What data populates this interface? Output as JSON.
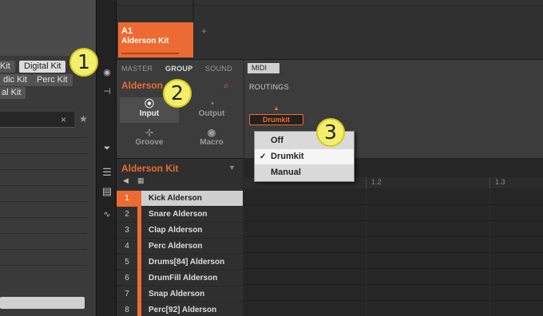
{
  "browser": {
    "kits": [
      "Kit",
      "Digital Kit",
      "dic Kit",
      "Perc Kit",
      "al Kit"
    ],
    "search_clear": "×",
    "favorite": "★"
  },
  "arranger": {
    "pattern_id": "A1",
    "pattern_name": "Alderson Kit",
    "add": "+"
  },
  "control": {
    "tabs": [
      "MASTER",
      "GROUP",
      "SOUND"
    ],
    "group_name": "Alderson",
    "buttons": [
      {
        "label": "Input",
        "icon": "input-icon",
        "glyph": "⦿"
      },
      {
        "label": "Output",
        "icon": "output-icon",
        "glyph": "◔"
      },
      {
        "label": "Groove",
        "icon": "groove-icon",
        "glyph": "⊹"
      },
      {
        "label": "Macro",
        "icon": "macro-icon",
        "glyph": "◉"
      }
    ],
    "midi_tab": "MIDI",
    "routings_label": "ROUTINGS",
    "routings_value": "Drumkit"
  },
  "dropdown": {
    "items": [
      "Off",
      "Drumkit",
      "Manual"
    ],
    "selected": "Drumkit"
  },
  "kit": {
    "title": "Alderson Kit",
    "sounds": [
      {
        "num": "1",
        "name": "Kick Alderson"
      },
      {
        "num": "2",
        "name": "Snare Alderson"
      },
      {
        "num": "3",
        "name": "Clap Alderson"
      },
      {
        "num": "4",
        "name": "Perc Alderson"
      },
      {
        "num": "5",
        "name": "Drums[84] Alderson"
      },
      {
        "num": "6",
        "name": "DrumFill Alderson"
      },
      {
        "num": "7",
        "name": "Snap Alderson"
      },
      {
        "num": "8",
        "name": "Perc[92] Alderson"
      }
    ]
  },
  "editor": {
    "ruler": [
      "1.2",
      "1.3"
    ]
  },
  "callouts": [
    "1",
    "2",
    "3"
  ],
  "colors": {
    "accent": "#ee6a33",
    "callout": "#f3ee6c"
  }
}
